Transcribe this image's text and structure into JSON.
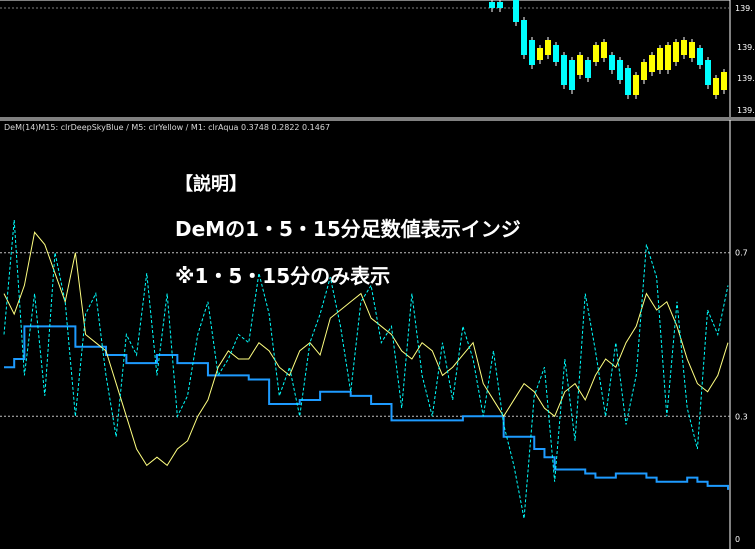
{
  "price_pane": {
    "axis_labels": [
      "139.",
      "139.",
      "139.",
      "139."
    ],
    "colors": {
      "bull": "#ffff00",
      "bear": "#00ffff",
      "frame": "#ffffff"
    }
  },
  "indicator_pane": {
    "header": "DeM(14)M15: clrDeepSkyBlue / M5: clrYellow / M1: clrAqua 0.3748 0.2822 0.1467",
    "levels": {
      "upper": "0.7",
      "lower": "0.3",
      "bottom": "0"
    },
    "overlay": {
      "title": "【説明】",
      "line1": "DeMの1・5・15分足数値表示インジ",
      "line2": "※1・5・15分のみ表示"
    },
    "colors": {
      "m15": "#1e9bff",
      "m5": "#ffff80",
      "m1": "#00ffff",
      "level": "#c0c0c0"
    }
  },
  "chart_data": {
    "type": "line",
    "ylim": [
      0,
      1
    ],
    "levels": [
      0.3,
      0.7
    ],
    "series": [
      {
        "name": "M15",
        "color": "#1e9bff",
        "values": [
          0.42,
          0.44,
          0.52,
          0.52,
          0.52,
          0.52,
          0.52,
          0.47,
          0.47,
          0.47,
          0.45,
          0.45,
          0.43,
          0.43,
          0.43,
          0.45,
          0.45,
          0.43,
          0.43,
          0.43,
          0.4,
          0.4,
          0.4,
          0.4,
          0.39,
          0.39,
          0.33,
          0.33,
          0.33,
          0.34,
          0.34,
          0.36,
          0.36,
          0.36,
          0.35,
          0.35,
          0.33,
          0.33,
          0.29,
          0.29,
          0.29,
          0.29,
          0.29,
          0.29,
          0.29,
          0.3,
          0.3,
          0.3,
          0.3,
          0.25,
          0.25,
          0.25,
          0.22,
          0.2,
          0.17,
          0.17,
          0.17,
          0.16,
          0.15,
          0.15,
          0.16,
          0.16,
          0.16,
          0.15,
          0.14,
          0.14,
          0.14,
          0.15,
          0.14,
          0.13,
          0.13,
          0.12
        ]
      },
      {
        "name": "M5",
        "color": "#ffff80",
        "values": [
          0.6,
          0.55,
          0.62,
          0.75,
          0.72,
          0.65,
          0.58,
          0.7,
          0.5,
          0.48,
          0.46,
          0.38,
          0.3,
          0.22,
          0.18,
          0.2,
          0.18,
          0.22,
          0.24,
          0.3,
          0.34,
          0.42,
          0.46,
          0.44,
          0.44,
          0.48,
          0.46,
          0.42,
          0.4,
          0.46,
          0.48,
          0.45,
          0.54,
          0.56,
          0.58,
          0.6,
          0.54,
          0.52,
          0.5,
          0.46,
          0.44,
          0.48,
          0.46,
          0.4,
          0.42,
          0.45,
          0.48,
          0.38,
          0.34,
          0.3,
          0.34,
          0.38,
          0.36,
          0.32,
          0.3,
          0.36,
          0.38,
          0.34,
          0.4,
          0.44,
          0.42,
          0.48,
          0.52,
          0.6,
          0.56,
          0.58,
          0.52,
          0.44,
          0.38,
          0.36,
          0.4,
          0.48
        ]
      },
      {
        "name": "M1",
        "color": "#00ffff",
        "values": [
          0.5,
          0.78,
          0.4,
          0.6,
          0.35,
          0.7,
          0.58,
          0.3,
          0.55,
          0.6,
          0.4,
          0.25,
          0.5,
          0.45,
          0.65,
          0.4,
          0.6,
          0.3,
          0.35,
          0.5,
          0.58,
          0.4,
          0.44,
          0.5,
          0.48,
          0.65,
          0.55,
          0.35,
          0.42,
          0.3,
          0.48,
          0.55,
          0.64,
          0.52,
          0.36,
          0.58,
          0.62,
          0.48,
          0.52,
          0.32,
          0.6,
          0.4,
          0.3,
          0.48,
          0.34,
          0.52,
          0.44,
          0.3,
          0.46,
          0.28,
          0.18,
          0.05,
          0.35,
          0.42,
          0.14,
          0.44,
          0.24,
          0.6,
          0.46,
          0.3,
          0.48,
          0.28,
          0.4,
          0.72,
          0.64,
          0.3,
          0.58,
          0.32,
          0.22,
          0.56,
          0.5,
          0.62
        ]
      }
    ]
  }
}
